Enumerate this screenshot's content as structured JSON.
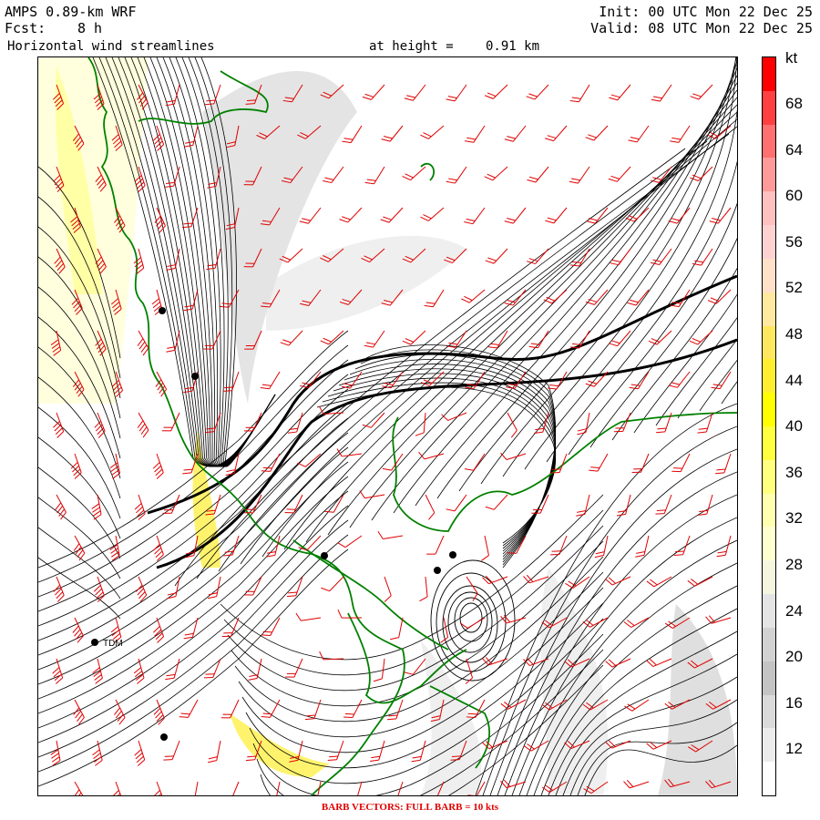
{
  "header": {
    "model": "AMPS 0.89-km WRF",
    "init": "Init: 00 UTC Mon 22 Dec 25",
    "fcst_label": "Fcst:",
    "fcst_value": "8 h",
    "valid": "Valid: 08 UTC Mon 22 Dec 25",
    "field": "Horizontal wind streamlines",
    "height_label": "at height =",
    "height_value": "0.91 km"
  },
  "footer": "BARB VECTORS:  FULL BARB = 10 kts",
  "colorbar": {
    "unit": "kt",
    "labels": [
      "68",
      "64",
      "60",
      "56",
      "52",
      "48",
      "44",
      "40",
      "36",
      "32",
      "28",
      "24",
      "20",
      "16",
      "12"
    ],
    "colors": [
      "#ff0000",
      "#ff4040",
      "#ff7070",
      "#ff9a9a",
      "#ffc0c0",
      "#ffd2d2",
      "#ffe0c8",
      "#ffe8a0",
      "#ffe860",
      "#ffee30",
      "#ffff00",
      "#ffff40",
      "#ffff80",
      "#ffffb0",
      "#ffffd0",
      "#f6f6e0",
      "#e4e4e4",
      "#d2d2d2",
      "#c4c4c4",
      "#dadada",
      "#ececec",
      "#ffffff"
    ]
  },
  "stations": [
    {
      "name": "TDM"
    }
  ],
  "colors": {
    "streamline": "#000000",
    "barb": "#e00000",
    "coast": "#008000"
  }
}
